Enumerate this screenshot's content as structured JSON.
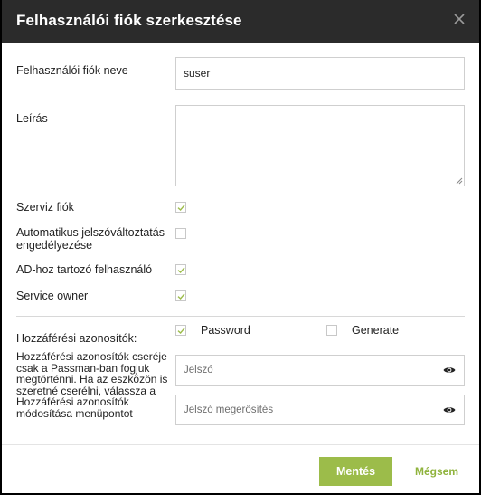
{
  "dialog": {
    "title": "Felhasználói fiók szerkesztése",
    "close_icon": "close-icon"
  },
  "form": {
    "account_name": {
      "label": "Felhasználói fiók neve",
      "value": "suser"
    },
    "description": {
      "label": "Leírás",
      "value": ""
    },
    "service_account": {
      "label": "Szerviz fiók",
      "checked": true
    },
    "auto_password_change": {
      "label": "Automatikus jelszóváltoztatás engedélyezése",
      "checked": false
    },
    "ad_user": {
      "label": "AD-hoz tartozó felhasználó",
      "checked": true
    },
    "service_owner": {
      "label": "Service owner",
      "checked": true
    },
    "credentials": {
      "label": "Hozzáférési azonosítók:",
      "password_option": {
        "label": "Password",
        "checked": true
      },
      "generate_option": {
        "label": "Generate",
        "checked": false
      }
    },
    "credentials_note": "Hozzáférési azonosítók cseréje csak a Passman-ban fogjuk megtörténni. Ha az eszközön is szeretné cserélni, válassza a Hozzáférési azonosítók módosítása menüpontot",
    "password": {
      "placeholder": "Jelszó",
      "icon": "eye-icon"
    },
    "password_confirm": {
      "placeholder": "Jelszó megerősítés",
      "icon": "eye-icon"
    }
  },
  "footer": {
    "save_label": "Mentés",
    "cancel_label": "Mégsem"
  },
  "colors": {
    "header_bg": "#2b2b2b",
    "accent": "#9cbc4a",
    "check_mark": "#9cbc4a"
  }
}
